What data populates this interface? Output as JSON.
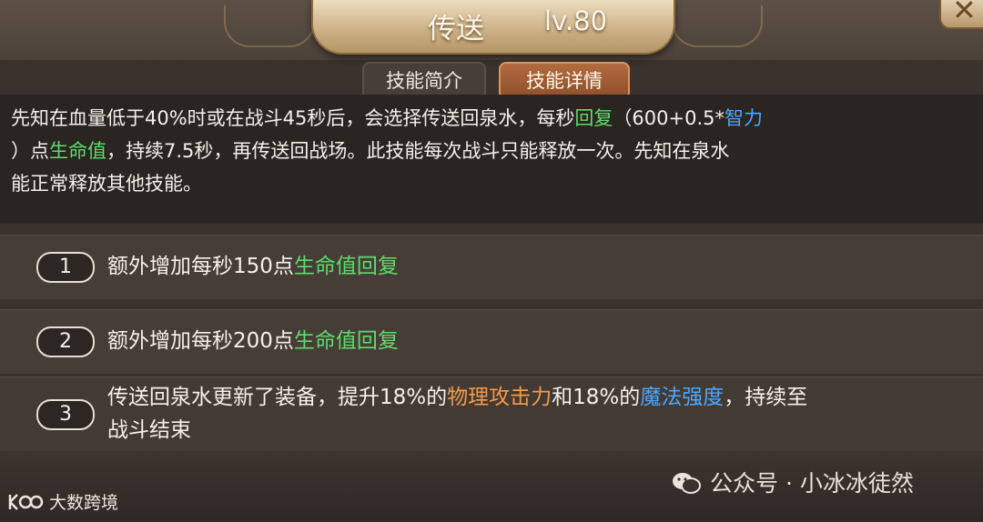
{
  "header": {
    "skill_name": "传送",
    "level": "lv.80",
    "close_label": "✕"
  },
  "tabs": {
    "brief": "技能简介",
    "detail": "技能详情"
  },
  "description": {
    "line1": {
      "a": "先知在血量低于40%时或在战斗45秒后，会选择传送回泉水，每秒",
      "b": "回复",
      "c": "（600+0.5*",
      "d": "智力"
    },
    "line2": {
      "a": "）点",
      "b": "生命值",
      "c": "，持续7.5秒，再传送回战场。此技能每次战斗只能释放一次。先知在泉水"
    },
    "line3": "能正常释放其他技能。"
  },
  "upgrades": [
    {
      "number": "1",
      "text": "额外增加每秒150点",
      "highlight": "生命值回复"
    },
    {
      "number": "2",
      "text": "额外增加每秒200点",
      "highlight": "生命值回复"
    },
    {
      "number": "3",
      "t1": "传送回泉水更新了装备，提升18%的",
      "h1": "物理攻击力",
      "t2": "和18%的",
      "h2": "魔法强度",
      "t3": "，持续至",
      "t4": "战斗结束"
    }
  ],
  "watermark": {
    "wechat": "公众号 · 小冰冰徒然",
    "brand": "大数跨境"
  },
  "colors": {
    "accent_green": "#5ddc6a",
    "accent_blue": "#4aa6ff",
    "accent_orange": "#f39a4a",
    "active_tab": "#a45f36"
  }
}
